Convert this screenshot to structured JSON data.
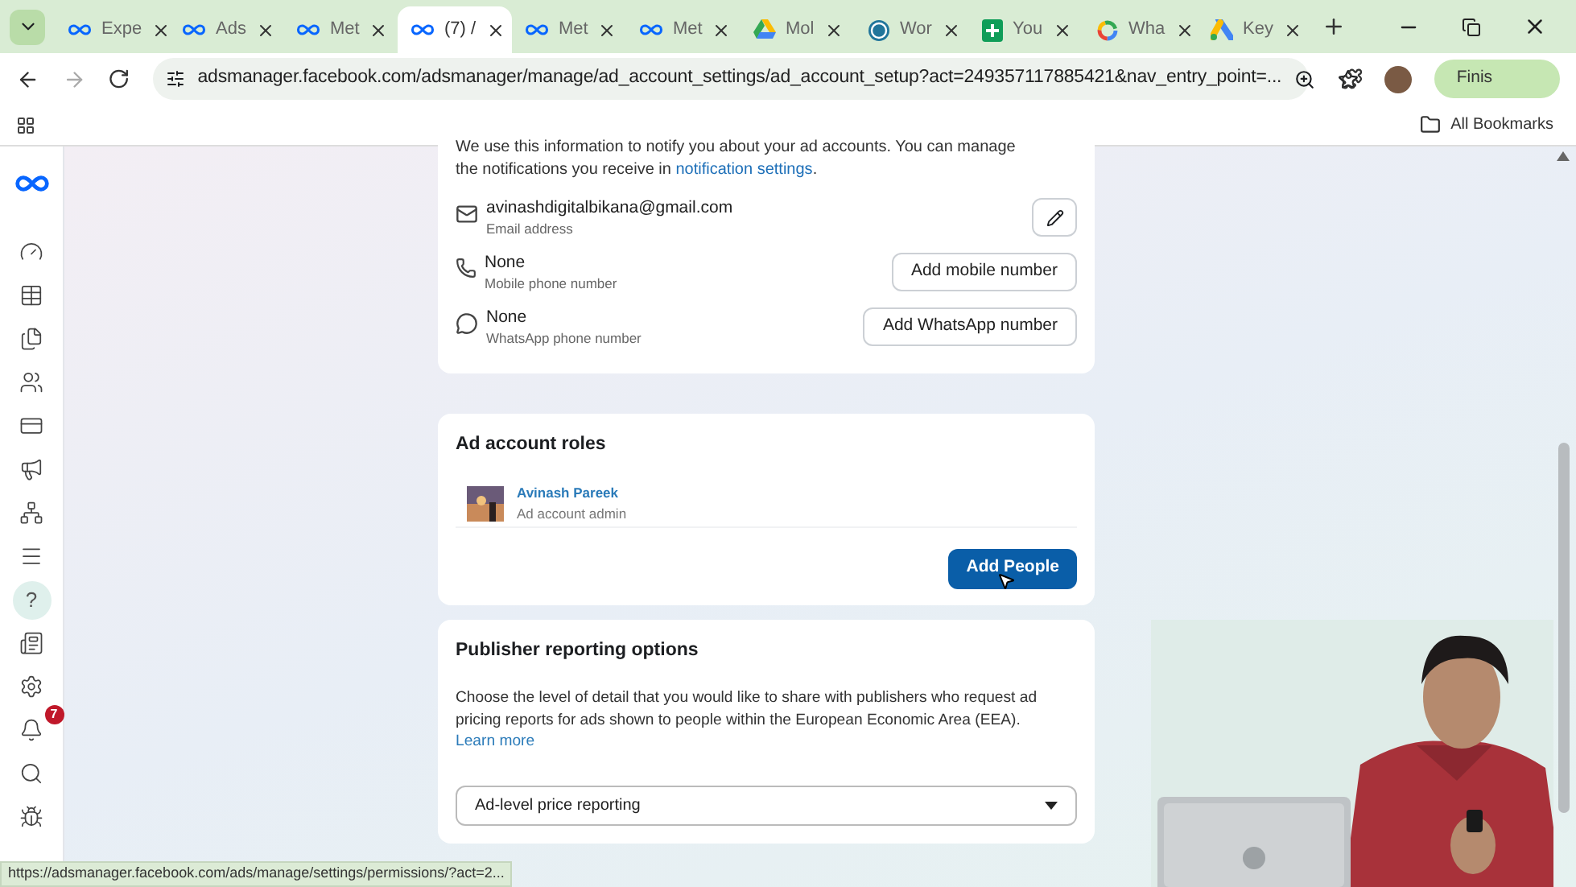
{
  "tabs": [
    {
      "label": "Expe",
      "selected": false
    },
    {
      "label": "Ads",
      "selected": false
    },
    {
      "label": "Met",
      "selected": false
    },
    {
      "label": "(7) /",
      "selected": true
    },
    {
      "label": "Met",
      "selected": false
    },
    {
      "label": "Met",
      "selected": false
    },
    {
      "label": "Mol",
      "selected": false
    },
    {
      "label": "Wor",
      "selected": false
    },
    {
      "label": "You",
      "selected": false
    },
    {
      "label": "Wha",
      "selected": false
    },
    {
      "label": "Key",
      "selected": false
    }
  ],
  "address_bar": {
    "url": "adsmanager.facebook.com/adsmanager/manage/ad_account_settings/ad_account_setup?act=249357117885421&nav_entry_point=..."
  },
  "profile_button": {
    "label": "Finis"
  },
  "bookmarks_bar": {
    "label": "All Bookmarks"
  },
  "sidebar": {
    "items": [
      {
        "selected": false
      },
      {
        "selected": false
      },
      {
        "selected": false
      },
      {
        "selected": false
      },
      {
        "selected": false
      },
      {
        "selected": false
      },
      {
        "selected": false
      },
      {
        "selected": false
      },
      {
        "selected": true,
        "glyph": "?"
      },
      {
        "selected": false
      },
      {
        "selected": false
      },
      {
        "selected": false,
        "badge": "7"
      },
      {
        "selected": false
      },
      {
        "selected": false
      }
    ]
  },
  "contact_card": {
    "intro": "We use this information to notify you about your ad accounts. You can manage the notifications you receive in",
    "intro_link": "notification settings",
    "intro_end": ".",
    "contacts": [
      {
        "kind": "email",
        "value": "avinashdigitalbikana@gmail.com",
        "label": "Email address"
      },
      {
        "kind": "phone",
        "value": "None",
        "label": "Mobile phone number",
        "action": "Add mobile number"
      },
      {
        "kind": "whatsapp",
        "value": "None",
        "label": "WhatsApp phone number",
        "action": "Add WhatsApp number"
      }
    ]
  },
  "roles_card": {
    "title": "Ad account roles",
    "members": [
      {
        "name": "Avinash Pareek",
        "role": "Ad account admin"
      }
    ],
    "button": "Add People"
  },
  "publisher_card": {
    "title": "Publisher reporting options",
    "description": "Choose the level of detail that you would like to share with publishers who request ad pricing reports for ads shown to people within the European Economic Area (EEA).",
    "link": "Learn more",
    "select": {
      "value": "Ad-level price reporting"
    }
  },
  "status_bar": {
    "url": "https://adsmanager.facebook.com/ads/manage/settings/permissions/?act=2..."
  }
}
